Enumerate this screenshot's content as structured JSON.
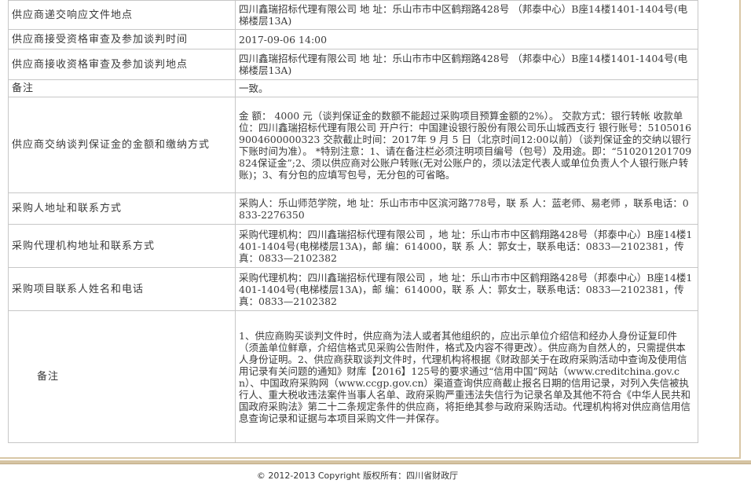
{
  "rows": [
    {
      "label": "供应商递交响应文件地点",
      "value": "四川鑫瑞招标代理有限公司 地 址：乐山市市中区鹤翔路428号 （邦泰中心）B座14楼1401-1404号(电梯楼层13A)"
    },
    {
      "label": "供应商接受资格审查及参加谈判时间",
      "value": "2017-09-06 14:00"
    },
    {
      "label": "供应商接收资格审查及参加谈判地点",
      "value": "四川鑫瑞招标代理有限公司 地 址：乐山市市中区鹤翔路428号 （邦泰中心）B座14楼1401-1404号(电梯楼层13A)"
    },
    {
      "label": "备注",
      "value": "一致。"
    },
    {
      "label": "供应商交纳谈判保证金的金额和缴纳方式",
      "value": "金 额： 4000 元（谈判保证金的数额不能超过采购项目预算金额的2%）。 交款方式：银行转帐 收款单位：四川鑫瑞招标代理有限公司 开户行：中国建设银行股份有限公司乐山城西支行 银行账号：51050169004600000323 交款截止时间：2017年 9 月 5 日（北京时间12:00以前）（谈判保证金的交纳以银行下账时间为准）。 *特别注意：1、请在备注栏必须注明项目编号（包号）及用途。即：“510201201709824保证金”;2、须以供应商对公账户转账(无对公账户的，须以法定代表人或单位负责人个人银行账户转账)；3、有分包的应填写包号，无分包的可省略。"
    },
    {
      "label": "采购人地址和联系方式",
      "value": "采购人：乐山师范学院，地 址：乐山市市中区滨河路778号，联 系 人：蓝老师、易老师 ，联系电话：0833-2276350"
    },
    {
      "label": "采购代理机构地址和联系方式",
      "value": "采购代理机构：四川鑫瑞招标代理有限公司 ，地 址：乐山市市中区鹤翔路428号（邦泰中心）B座14楼1401-1404号(电梯楼层13A)，邮 编：614000，联 系 人：郭女士，联系电话：0833—2102381，传 真：0833—2102382"
    },
    {
      "label": "采购项目联系人姓名和电话",
      "value": "采购代理机构：四川鑫瑞招标代理有限公司 ，地 址：乐山市市中区鹤翔路428号（邦泰中心）B座14楼1401-1404号(电梯楼层13A)，邮 编：614000，联 系 人：郭女士，联系电话：0833—2102381，传 真：0833—2102382"
    },
    {
      "label": "备注",
      "value": "1、供应商购买谈判文件时，供应商为法人或者其他组织的，应出示单位介绍信和经办人身份证复印件（须盖单位鲜章，介绍信格式见采购公告附件，格式及内容不得更改）。供应商为自然人的，只需提供本人身份证明。2、供应商获取谈判文件时，代理机构将根据《财政部关于在政府采购活动中查询及使用信用记录有关问题的通知》财库【2016】125号的要求通过“信用中国”网站（www.creditchina.gov.cn）、中国政府采购网（www.ccgp.gov.cn）渠道查询供应商截止报名日期的信用记录，对列入失信被执行人、重大税收违法案件当事人名单、政府采购严重违法失信行为记录名单及其他不符合《中华人民共和国政府采购法》第二十二条规定条件的供应商，将拒绝其参与政府采购活动。代理机构将对供应商信用信息查询记录和证据与本项目采购文件一并保存。"
    }
  ],
  "footer": {
    "copyright": "© 2012-2013 Copyright 版权所有：四川省财政厅"
  }
}
